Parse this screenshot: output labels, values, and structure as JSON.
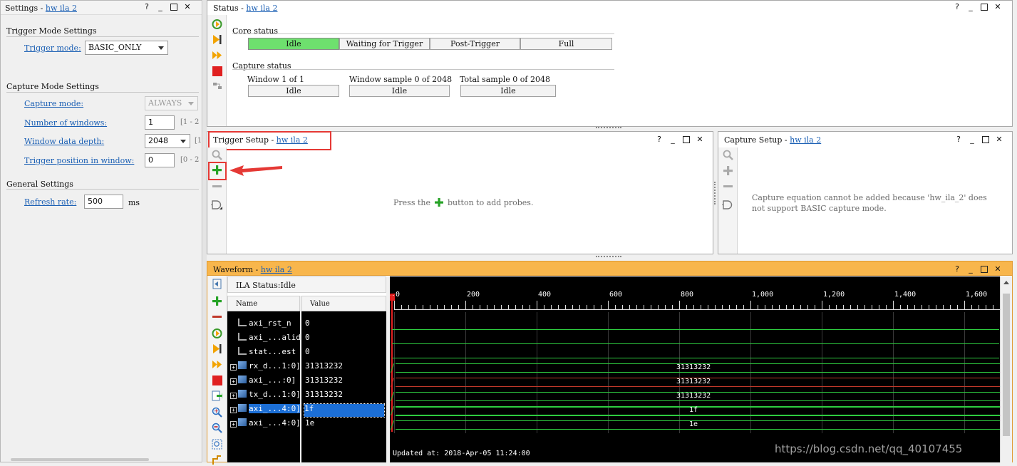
{
  "settings": {
    "title": "Settings",
    "device": "hw ila 2",
    "trigger_mode_section": "Trigger Mode Settings",
    "trigger_mode_label": "Trigger mode:",
    "trigger_mode_value": "BASIC_ONLY",
    "capture_mode_section": "Capture Mode Settings",
    "capture_mode_label": "Capture mode:",
    "capture_mode_value": "ALWAYS",
    "num_windows_label": "Number of windows:",
    "num_windows_value": "1",
    "num_windows_hint": "[1 - 2",
    "window_depth_label": "Window data depth:",
    "window_depth_value": "2048",
    "window_depth_hint": "[1",
    "trigger_pos_label": "Trigger position in window:",
    "trigger_pos_value": "0",
    "trigger_pos_hint": "[0 - 2",
    "general_section": "General Settings",
    "refresh_label": "Refresh rate:",
    "refresh_value": "500",
    "refresh_unit": "ms"
  },
  "window_controls": {
    "help": "?",
    "minimize": "_"
  },
  "status": {
    "title": "Status",
    "device": "hw ila 2",
    "core_status_label": "Core status",
    "core_states": [
      "Idle",
      "Waiting for Trigger",
      "Post-Trigger",
      "Full"
    ],
    "active_state": "Idle",
    "capture_status_label": "Capture status",
    "window_label": "Window 1 of 1",
    "window_value": "Idle",
    "window_sample_label": "Window sample 0 of 2048",
    "window_sample_value": "Idle",
    "total_sample_label": "Total sample 0 of 2048",
    "total_sample_value": "Idle"
  },
  "trigger_setup": {
    "title": "Trigger Setup",
    "device": "hw ila 2",
    "msg_before": "Press the",
    "msg_after": "button to add probes."
  },
  "capture_setup": {
    "title": "Capture Setup",
    "device": "hw ila 2",
    "msg_line1": "Capture equation cannot be added because 'hw_ila_2' does",
    "msg_line2": "not support BASIC capture mode."
  },
  "waveform": {
    "title": "Waveform",
    "device": "hw ila 2",
    "ila_status": "ILA Status:Idle",
    "col_name": "Name",
    "col_value": "Value",
    "signals": [
      {
        "name": "axi_rst_n",
        "value": "0",
        "bus": false,
        "wave": "0"
      },
      {
        "name": "axi_...alid",
        "value": "0",
        "bus": false,
        "wave": "0"
      },
      {
        "name": "stat...est",
        "value": "0",
        "bus": false,
        "wave": "0"
      },
      {
        "name": "rx_d...1:0]",
        "value": "31313232",
        "bus": true,
        "wave": "31313232"
      },
      {
        "name": "axi_...:0]",
        "value": "31313232",
        "bus": true,
        "wave": "31313232"
      },
      {
        "name": "tx_d...1:0]",
        "value": "31313232",
        "bus": true,
        "wave": "31313232"
      },
      {
        "name": "axi_...4:0]",
        "value": "1f",
        "bus": true,
        "wave": "1f",
        "selected": true
      },
      {
        "name": "axi_...4:0]",
        "value": "1e",
        "bus": true,
        "wave": "1e"
      }
    ],
    "axis_labels": [
      "0",
      "200",
      "400",
      "600",
      "800",
      "1,000",
      "1,200",
      "1,400",
      "1,600"
    ],
    "updated": "Updated at: 2018-Apr-05 11:24:00",
    "trigger_marker": "T",
    "watermark": "https://blog.csdn.net/qq_40107455"
  },
  "colors": {
    "active_state": "#6ee06e",
    "waveform_header": "#f5a623",
    "trace": "#2ecc40",
    "highlight_box": "#e53935"
  }
}
